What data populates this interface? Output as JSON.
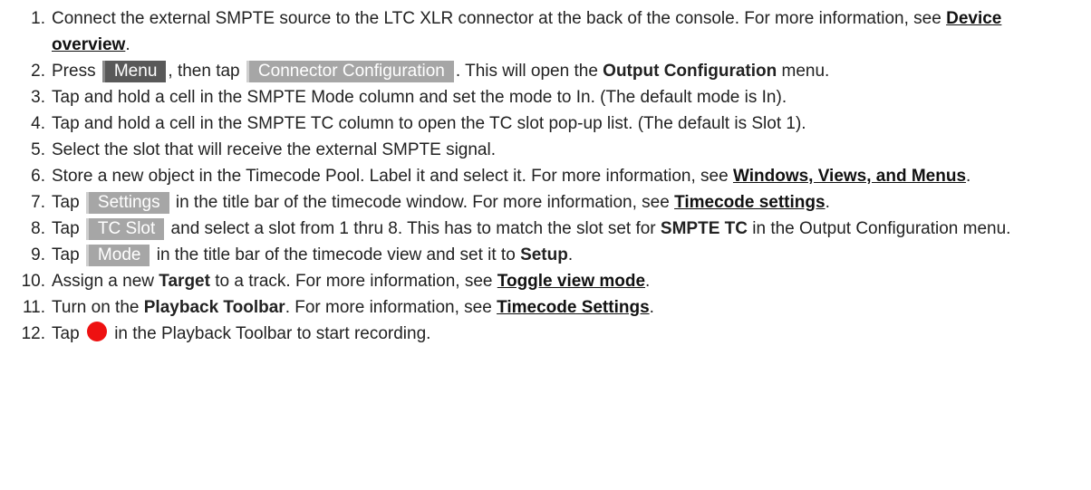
{
  "steps": [
    {
      "num": "1.",
      "a": "Connect the external SMPTE source to the LTC XLR connector at the back of the console. For more information, see ",
      "link": "Device overview",
      "b": "."
    },
    {
      "num": "2.",
      "a": "Press ",
      "key1": "Menu",
      "b": ", then tap ",
      "key2": "Connector Configuration",
      "c": ". This will open the ",
      "bold": "Output Configuration",
      "d": " menu."
    },
    {
      "num": "3.",
      "text": "Tap and hold a cell in the SMPTE Mode column and set the mode to In. (The default mode is In)."
    },
    {
      "num": "4.",
      "text": "Tap and hold a cell in the SMPTE TC column to open the TC slot pop-up list. (The default is Slot 1)."
    },
    {
      "num": "5.",
      "text": "Select the slot that will receive the external SMPTE signal."
    },
    {
      "num": "6.",
      "a": "Store a new object in the Timecode Pool. Label it and select it. For more information, see ",
      "link": "Windows, Views, and Menus",
      "b": "."
    },
    {
      "num": "7.",
      "a": "Tap ",
      "key": "Settings",
      "b": " in the title bar of the timecode window. For more information, see ",
      "link": "Timecode settings",
      "c": "."
    },
    {
      "num": "8.",
      "a": "Tap ",
      "key": "TC Slot",
      "b": " and select a slot from 1 thru 8. This has to match the slot set for ",
      "bold": "SMPTE TC",
      "c": " in the Output Configuration menu."
    },
    {
      "num": "9.",
      "a": "Tap ",
      "key": "Mode",
      "b": " in the title bar of the timecode view and set it to ",
      "bold": "Setup",
      "c": "."
    },
    {
      "num": "10.",
      "a": "Assign a new ",
      "bold": "Target",
      "b": " to a track. For more information, see ",
      "link": "Toggle view mode",
      "c": "."
    },
    {
      "num": "11.",
      "a": "Turn on the ",
      "bold": "Playback Toolbar",
      "b": ". For more information, see ",
      "link": "Timecode Settings",
      "c": "."
    },
    {
      "num": "12.",
      "a": "Tap ",
      "icon": "record-icon",
      "b": " in the Playback Toolbar to start recording."
    }
  ],
  "colors": {
    "record": "#ee1111",
    "key_dark": "#595959",
    "key_light": "#a6a6a6"
  }
}
